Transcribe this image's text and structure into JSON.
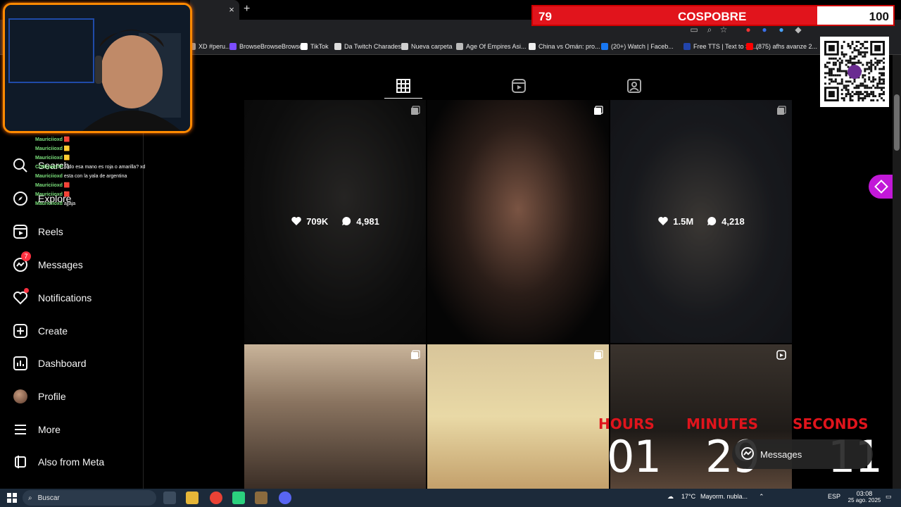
{
  "browser": {
    "new_tab_glyph": "+",
    "close_tab_glyph": "×",
    "bookmarks": [
      {
        "label": "XD #peru...",
        "color": "#9b9b9b"
      },
      {
        "label": "BrowseBrowseBrowse",
        "color": "#7c4dff"
      },
      {
        "label": "TikTok",
        "color": "#ffffff"
      },
      {
        "label": "Da Twitch Charades",
        "color": "#dddddd"
      },
      {
        "label": "Nueva carpeta",
        "color": "#cfcfcf"
      },
      {
        "label": "Age Of Empires Asi...",
        "color": "#bbbbbb"
      },
      {
        "label": "China vs Omán: pro...",
        "color": "#eeeeee"
      },
      {
        "label": "(20+) Watch | Faceb...",
        "color": "#1877f2"
      },
      {
        "label": "Free TTS | Text to Sp...",
        "color": "#2244aa"
      },
      {
        "label": "(875) afhs avanze 2...",
        "color": "#ff0000"
      }
    ]
  },
  "sidebar": {
    "items": [
      {
        "label": "Search",
        "icon": "search-icon"
      },
      {
        "label": "Explore",
        "icon": "compass-icon"
      },
      {
        "label": "Reels",
        "icon": "reels-icon"
      },
      {
        "label": "Messages",
        "icon": "messenger-icon",
        "badge": "7"
      },
      {
        "label": "Notifications",
        "icon": "heart-icon"
      },
      {
        "label": "Create",
        "icon": "plus-square-icon"
      },
      {
        "label": "Dashboard",
        "icon": "dashboard-icon"
      },
      {
        "label": "Profile",
        "icon": "avatar"
      },
      {
        "label": "More",
        "icon": "menu-icon"
      },
      {
        "label": "Also from Meta",
        "icon": "meta-icon"
      }
    ]
  },
  "profile_tabs": [
    "posts-grid-icon",
    "reels-icon",
    "tagged-icon"
  ],
  "posts": [
    {
      "likes": "709K",
      "comments": "4,981",
      "kind": "carousel",
      "hover": true
    },
    {
      "likes": "",
      "comments": "",
      "kind": "carousel",
      "hover": false
    },
    {
      "likes": "1.5M",
      "comments": "4,218",
      "kind": "carousel",
      "hover": true
    },
    {
      "likes": "",
      "comments": "",
      "kind": "carousel",
      "hover": false
    },
    {
      "likes": "",
      "comments": "",
      "kind": "carousel",
      "hover": false
    },
    {
      "likes": "",
      "comments": "",
      "kind": "reel",
      "hover": false
    }
  ],
  "chat": [
    {
      "user": "Mauriciioxd",
      "msg": "🟥"
    },
    {
      "user": "Mauriciioxd",
      "msg": "🟨"
    },
    {
      "user": "Mauriciioxd",
      "msg": "🟨"
    },
    {
      "user": "CDEIyainTP",
      "msg": "todo esa mano es roja o amarilla? xd"
    },
    {
      "user": "Mauriciioxd",
      "msg": "esta con la yala de argentina"
    },
    {
      "user": "Mauriciioxd",
      "msg": "🟥"
    },
    {
      "user": "Mauriciioxd",
      "msg": "🟥"
    },
    {
      "user": "Mauriciioxd",
      "msg": "ajjaja"
    }
  ],
  "goal": {
    "current": "79",
    "title": "COSPOBRE",
    "target": "100",
    "progress": 0.79
  },
  "qr": {
    "brand": "yape"
  },
  "timer": {
    "hours_label": "HOURS",
    "hours": "01",
    "minutes_label": "MINUTES",
    "minutes": "29",
    "seconds_label": "SECONDS",
    "seconds": "11"
  },
  "messages_pill": {
    "label": "Messages"
  },
  "taskbar": {
    "search_placeholder": "Buscar",
    "weather": "17°C",
    "weather_desc": "Mayorm. nubla...",
    "lang": "ESP",
    "time": "03:08",
    "date": "25 ago. 2025"
  },
  "colors": {
    "accent_red": "#e1141c",
    "webcam_border": "#ff8a00",
    "badge": "#ff3040"
  }
}
